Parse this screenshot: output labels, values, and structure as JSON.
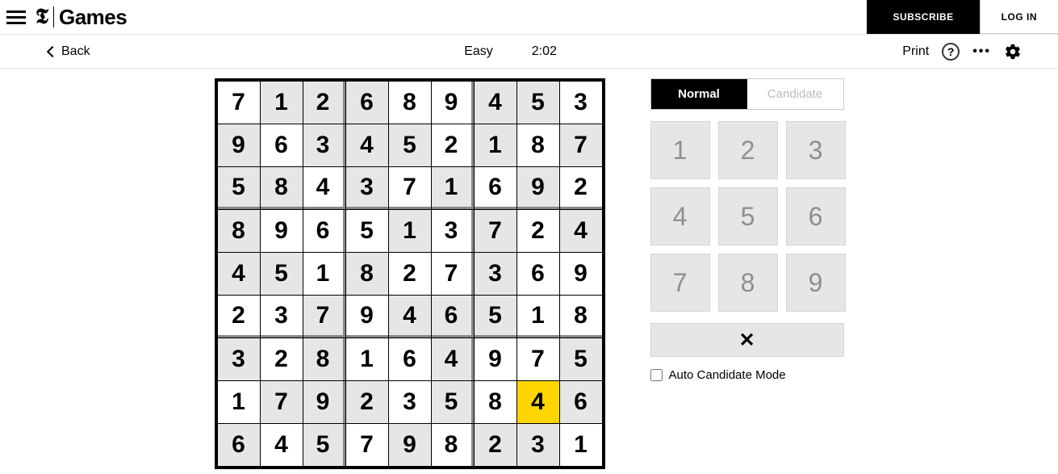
{
  "header": {
    "brand_t": "𝕿",
    "brand_games": "Games",
    "subscribe": "SUBSCRIBE",
    "login": "LOG IN"
  },
  "subbar": {
    "back": "Back",
    "difficulty": "Easy",
    "timer": "2:02",
    "print": "Print",
    "help": "?",
    "more": "•••"
  },
  "modes": {
    "normal": "Normal",
    "candidate": "Candidate"
  },
  "numpad": [
    "1",
    "2",
    "3",
    "4",
    "5",
    "6",
    "7",
    "8",
    "9"
  ],
  "clear": "✕",
  "autocandidate": "Auto Candidate Mode",
  "selected": {
    "row": 7,
    "col": 7
  },
  "board": {
    "rows": [
      [
        {
          "v": "7",
          "g": false
        },
        {
          "v": "1",
          "g": true
        },
        {
          "v": "2",
          "g": true
        },
        {
          "v": "6",
          "g": true
        },
        {
          "v": "8",
          "g": false
        },
        {
          "v": "9",
          "g": false
        },
        {
          "v": "4",
          "g": true
        },
        {
          "v": "5",
          "g": true
        },
        {
          "v": "3",
          "g": false
        }
      ],
      [
        {
          "v": "9",
          "g": true
        },
        {
          "v": "6",
          "g": false
        },
        {
          "v": "3",
          "g": true
        },
        {
          "v": "4",
          "g": true
        },
        {
          "v": "5",
          "g": true
        },
        {
          "v": "2",
          "g": false
        },
        {
          "v": "1",
          "g": true
        },
        {
          "v": "8",
          "g": false
        },
        {
          "v": "7",
          "g": true
        }
      ],
      [
        {
          "v": "5",
          "g": true
        },
        {
          "v": "8",
          "g": true
        },
        {
          "v": "4",
          "g": false
        },
        {
          "v": "3",
          "g": true
        },
        {
          "v": "7",
          "g": false
        },
        {
          "v": "1",
          "g": true
        },
        {
          "v": "6",
          "g": false
        },
        {
          "v": "9",
          "g": true
        },
        {
          "v": "2",
          "g": false
        }
      ],
      [
        {
          "v": "8",
          "g": true
        },
        {
          "v": "9",
          "g": false
        },
        {
          "v": "6",
          "g": false
        },
        {
          "v": "5",
          "g": false
        },
        {
          "v": "1",
          "g": true
        },
        {
          "v": "3",
          "g": false
        },
        {
          "v": "7",
          "g": true
        },
        {
          "v": "2",
          "g": false
        },
        {
          "v": "4",
          "g": true
        }
      ],
      [
        {
          "v": "4",
          "g": true
        },
        {
          "v": "5",
          "g": true
        },
        {
          "v": "1",
          "g": false
        },
        {
          "v": "8",
          "g": true
        },
        {
          "v": "2",
          "g": false
        },
        {
          "v": "7",
          "g": false
        },
        {
          "v": "3",
          "g": true
        },
        {
          "v": "6",
          "g": false
        },
        {
          "v": "9",
          "g": false
        }
      ],
      [
        {
          "v": "2",
          "g": false
        },
        {
          "v": "3",
          "g": false
        },
        {
          "v": "7",
          "g": true
        },
        {
          "v": "9",
          "g": false
        },
        {
          "v": "4",
          "g": true
        },
        {
          "v": "6",
          "g": true
        },
        {
          "v": "5",
          "g": true
        },
        {
          "v": "1",
          "g": false
        },
        {
          "v": "8",
          "g": false
        }
      ],
      [
        {
          "v": "3",
          "g": true
        },
        {
          "v": "2",
          "g": false
        },
        {
          "v": "8",
          "g": true
        },
        {
          "v": "1",
          "g": false
        },
        {
          "v": "6",
          "g": false
        },
        {
          "v": "4",
          "g": true
        },
        {
          "v": "9",
          "g": false
        },
        {
          "v": "7",
          "g": false
        },
        {
          "v": "5",
          "g": true
        }
      ],
      [
        {
          "v": "1",
          "g": false
        },
        {
          "v": "7",
          "g": true
        },
        {
          "v": "9",
          "g": true
        },
        {
          "v": "2",
          "g": true
        },
        {
          "v": "3",
          "g": false
        },
        {
          "v": "5",
          "g": true
        },
        {
          "v": "8",
          "g": false
        },
        {
          "v": "4",
          "g": false
        },
        {
          "v": "6",
          "g": true
        }
      ],
      [
        {
          "v": "6",
          "g": true
        },
        {
          "v": "4",
          "g": false
        },
        {
          "v": "5",
          "g": true
        },
        {
          "v": "7",
          "g": false
        },
        {
          "v": "9",
          "g": true
        },
        {
          "v": "8",
          "g": false
        },
        {
          "v": "2",
          "g": true
        },
        {
          "v": "3",
          "g": true
        },
        {
          "v": "1",
          "g": false
        }
      ]
    ]
  }
}
